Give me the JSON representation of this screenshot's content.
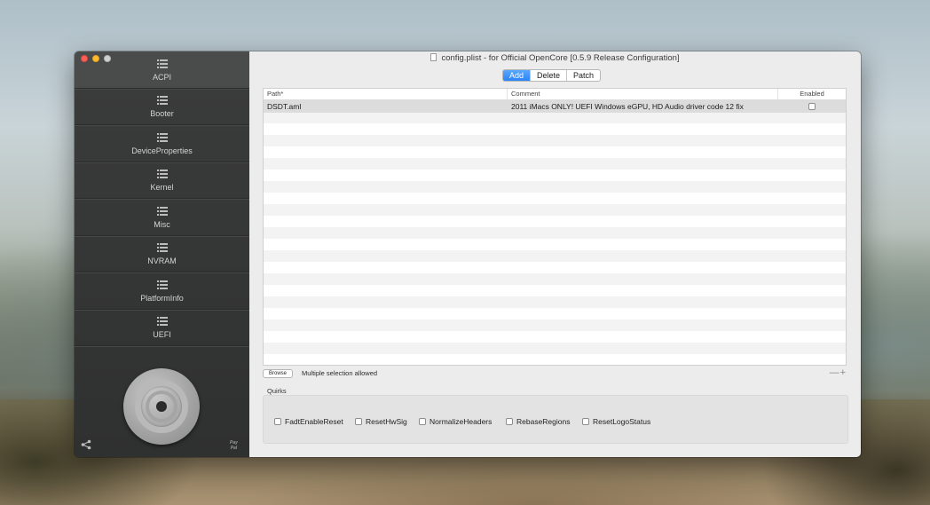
{
  "window": {
    "title": "config.plist - for Official OpenCore [0.5.9 Release Configuration]"
  },
  "sidebar": {
    "items": [
      {
        "label": "ACPI",
        "active": true
      },
      {
        "label": "Booter"
      },
      {
        "label": "DeviceProperties"
      },
      {
        "label": "Kernel"
      },
      {
        "label": "Misc"
      },
      {
        "label": "NVRAM"
      },
      {
        "label": "PlatformInfo"
      },
      {
        "label": "UEFI"
      }
    ],
    "paypal_line1": "Pay",
    "paypal_line2": "Pal"
  },
  "tabs": [
    {
      "label": "Add",
      "selected": true
    },
    {
      "label": "Delete"
    },
    {
      "label": "Patch"
    }
  ],
  "table": {
    "columns": [
      "Path*",
      "Comment",
      "Enabled"
    ],
    "rows": [
      {
        "path": "DSDT.aml",
        "comment": "2011 iMacs ONLY! UEFI Windows eGPU, HD Audio driver code 12 fix",
        "enabled": false
      }
    ]
  },
  "footer": {
    "browse_label": "Browse",
    "hint": "Multiple selection allowed",
    "minus_plus": "—+"
  },
  "quirks": {
    "label": "Quirks",
    "items": [
      {
        "label": "FadtEnableReset",
        "checked": false
      },
      {
        "label": "ResetHwSig",
        "checked": false
      },
      {
        "label": "NormalizeHeaders",
        "checked": false
      },
      {
        "label": "RebaseRegions",
        "checked": false
      },
      {
        "label": "ResetLogoStatus",
        "checked": false
      }
    ]
  },
  "icons": {
    "sidebar_item": "list-icon",
    "document": "document-icon",
    "share": "share-icon",
    "knob": "opencore-logo"
  },
  "colors": {
    "accent": "#2b83f6",
    "sidebar": "#353636",
    "traffic_close": "#fc5f57",
    "traffic_min": "#fdbc2e"
  }
}
